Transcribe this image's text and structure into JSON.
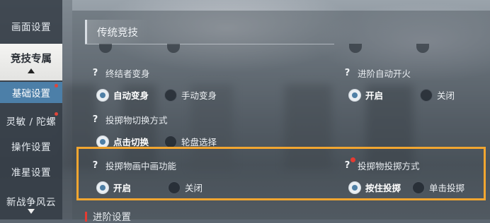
{
  "sidebar": {
    "items": [
      {
        "label": "画面设置"
      },
      {
        "label": "竞技专属"
      },
      {
        "label": "基础设置"
      },
      {
        "label": "灵敏 / 陀螺"
      },
      {
        "label": "操作设置"
      },
      {
        "label": "准星设置"
      },
      {
        "label": "新战争风云"
      }
    ]
  },
  "main": {
    "section_title": "传统竞技",
    "next_section_title": "进阶设置",
    "settings": {
      "finisher": {
        "title": "终结者变身",
        "options": [
          "自动变身",
          "手动变身"
        ],
        "selected": "自动变身"
      },
      "auto_fire": {
        "title": "进阶自动开火",
        "options": [
          "开启",
          "关闭"
        ],
        "selected": "开启"
      },
      "throw_switch": {
        "title": "投掷物切换方式",
        "options": [
          "点击切换",
          "轮盘选择"
        ],
        "selected": "点击切换"
      },
      "throw_pip": {
        "title": "投掷物画中画功能",
        "options": [
          "开启",
          "关闭"
        ],
        "selected": "开启"
      },
      "throw_mode": {
        "title": "投掷物投掷方式",
        "options": [
          "按住投掷",
          "单击投掷"
        ],
        "selected": "按住投掷"
      }
    }
  },
  "colors": {
    "highlight_border": "#f2a630",
    "radio_dot": "#4e7fa5",
    "notification_dot": "#e53b32"
  }
}
